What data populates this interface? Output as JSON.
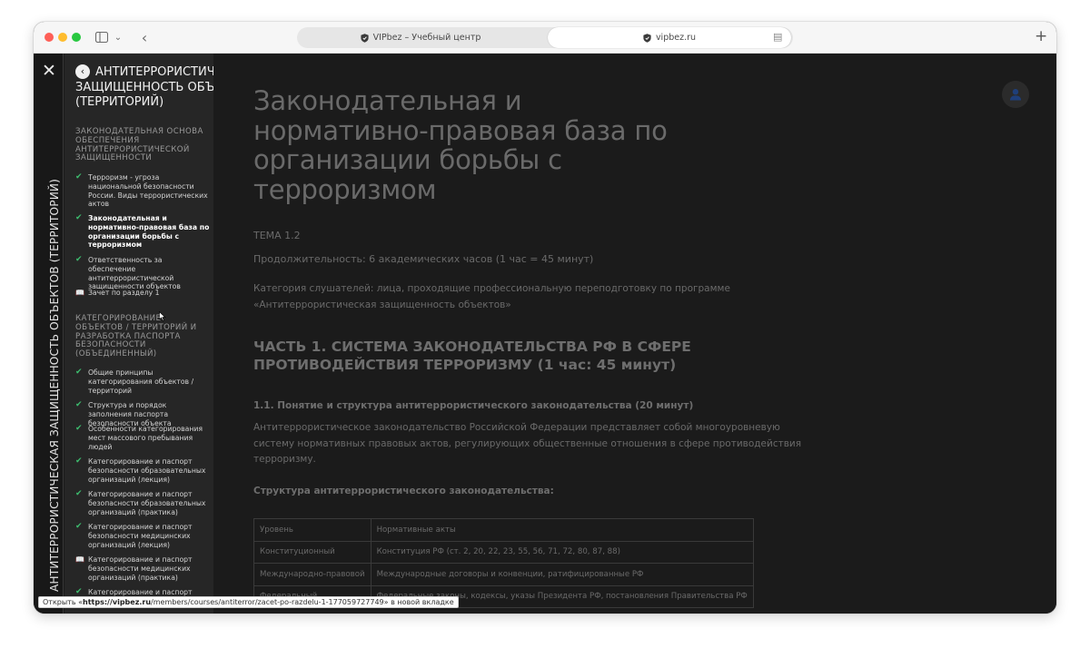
{
  "browser": {
    "tabs": [
      {
        "label": "VIPbez – Учебный центр"
      },
      {
        "label": "vipbez.ru"
      }
    ]
  },
  "course": {
    "vertical_title": "АНТИТЕРРОРИСТИЧЕСКАЯ ЗАЩИЩЕННОСТЬ ОБЪЕКТОВ (ТЕРРИТОРИЙ)",
    "header_line1": "АНТИТЕРРОРИСТИЧЕ",
    "header_line2": "ЗАЩИЩЕННОСТЬ ОБЪЕК",
    "header_line3": "(ТЕРРИТОРИЙ)",
    "sections": [
      {
        "title": "ЗАКОНОДАТЕЛЬНАЯ ОСНОВА ОБЕСПЕЧЕНИЯ АНТИТЕРРОРИСТИЧЕСКОЙ ЗАЩИЩЕННОСТИ",
        "lessons": [
          {
            "label": "Терроризм - угроза национальной безопасности России. Виды террористических актов",
            "status": "done"
          },
          {
            "label": "Законодательная и нормативно-правовая база по организации борьбы с терроризмом",
            "status": "done"
          },
          {
            "label": "Ответственность за обеспечение антитеррористической защищенности объектов",
            "status": "done"
          },
          {
            "label": "Зачет по разделу 1",
            "status": "quiz"
          }
        ]
      },
      {
        "title": "КАТЕГОРИРОВАНИЕ ОБЪЕКТОВ / ТЕРРИТОРИЙ И РАЗРАБОТКА ПАСПОРТА БЕЗОПАСНОСТИ (ОБЪЕДИНЕННЫЙ)",
        "lessons": [
          {
            "label": "Общие принципы категорирования объектов / территорий",
            "status": "done"
          },
          {
            "label": "Структура и порядок заполнения паспорта безопасности объекта",
            "status": "done"
          },
          {
            "label": "Особенности категорирования мест массового пребывания людей",
            "status": "done"
          },
          {
            "label": "Категорирование и паспорт безопасности образовательных организаций (лекция)",
            "status": "done"
          },
          {
            "label": "Категорирование и паспорт безопасности образовательных организаций (практика)",
            "status": "done"
          },
          {
            "label": "Категорирование и паспорт безопасности медицинских организаций (лекция)",
            "status": "done"
          },
          {
            "label": "Категорирование и паспорт безопасности медицинских организаций (практика)",
            "status": "quiz"
          },
          {
            "label": "Категорирование и паспорт средств размещения (лекция)",
            "status": "done"
          }
        ]
      }
    ]
  },
  "main": {
    "title": "Законодательная и нормативно-правовая база по организации борьбы с терроризмом",
    "topic": "ТЕМА 1.2",
    "duration": "Продолжительность: 6 академических часов (1 час = 45 минут)",
    "audience": "Категория слушателей: лица, проходящие профессиональную переподготовку по программе «Антитеррористическая защищенность объектов»",
    "part_heading": "ЧАСТЬ 1. СИСТЕМА ЗАКОНОДАТЕЛЬСТВА РФ В СФЕРЕ ПРОТИВОДЕЙСТВИЯ ТЕРРОРИЗМУ (1 час: 45 минут)",
    "sub_heading": "1.1. Понятие и структура антитеррористического законодательства (20 минут)",
    "intro": "Антитеррористическое законодательство Российской Федерации представляет собой многоуровневую систему нормативных правовых актов, регулирующих общественные отношения в сфере противодействия терроризму.",
    "structure_heading": "Структура антитеррористического законодательства:",
    "table": {
      "headers": [
        "Уровень",
        "Нормативные акты"
      ],
      "rows": [
        [
          "Конституционный",
          "Конституция РФ (ст. 2, 20, 22, 23, 55, 56, 71, 72, 80, 87, 88)"
        ],
        [
          "Международно-правовой",
          "Международные договоры и конвенции, ратифицированные РФ"
        ],
        [
          "Федеральный",
          "Федеральные законы, кодексы, указы Президента РФ, постановления Правительства РФ"
        ]
      ]
    }
  },
  "statusbar": {
    "prefix": "Открыть «",
    "host": "https://vipbez.ru",
    "path": "/members/courses/antiterror/zacet-po-razdelu-1-177059727749",
    "suffix": "» в новой вкладке"
  }
}
